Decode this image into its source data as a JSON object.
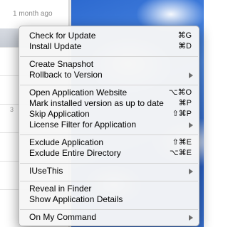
{
  "background": {
    "relative_time": "1 month ago",
    "row_number": "3"
  },
  "menu": {
    "items": [
      {
        "label": "Check for Update",
        "shortcut": "⌘G",
        "submenu": false
      },
      {
        "label": "Install Update",
        "shortcut": "⌘D",
        "submenu": false
      },
      {
        "label": "Create Snapshot",
        "shortcut": "",
        "submenu": false
      },
      {
        "label": "Rollback to Version",
        "shortcut": "",
        "submenu": true
      },
      {
        "label": "Open Application Website",
        "shortcut": "⌥⌘O",
        "submenu": false
      },
      {
        "label": "Mark installed version as up to date",
        "shortcut": "⌘P",
        "submenu": false
      },
      {
        "label": "Skip Application",
        "shortcut": "⇧⌘P",
        "submenu": false
      },
      {
        "label": "License Filter for Application",
        "shortcut": "",
        "submenu": true
      },
      {
        "label": "Exclude Application",
        "shortcut": "⇧⌘E",
        "submenu": false
      },
      {
        "label": "Exclude Entire Directory",
        "shortcut": "⌥⌘E",
        "submenu": false
      },
      {
        "label": "IUseThis",
        "shortcut": "",
        "submenu": true
      },
      {
        "label": "Reveal in Finder",
        "shortcut": "",
        "submenu": false
      },
      {
        "label": "Show Application Details",
        "shortcut": "",
        "submenu": false
      },
      {
        "label": "On My Command",
        "shortcut": "",
        "submenu": true
      }
    ]
  }
}
